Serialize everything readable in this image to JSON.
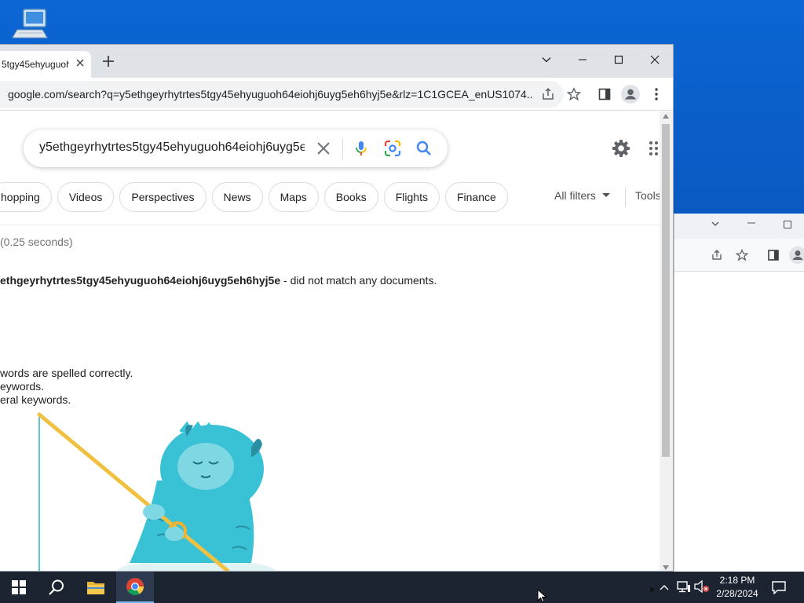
{
  "browser": {
    "tab_title": "5tgy45ehyuguoh",
    "url": "google.com/search?q=y5ethgeyrhytrtes5tgy45ehyuguoh64eiohj6uyg5eh6hyj5e&rlz=1C1GCEA_enUS1074..."
  },
  "search": {
    "query": "y5ethgeyrhytrtes5tgy45ehyuguoh64eiohj6uyg5e"
  },
  "chips": [
    {
      "label": "hopping"
    },
    {
      "label": "Videos"
    },
    {
      "label": "Perspectives"
    },
    {
      "label": "News"
    },
    {
      "label": "Maps"
    },
    {
      "label": "Books"
    },
    {
      "label": "Flights"
    },
    {
      "label": "Finance"
    }
  ],
  "filters": {
    "all_filters": "All filters",
    "tools": "Tools"
  },
  "results": {
    "stats": "0.25 seconds)",
    "no_match_query": "ethgeyrhytrtes5tgy45ehyuguoh64eiohj6uyg5eh6hyj5e",
    "no_match_suffix": " - did not match any documents.",
    "suggestions": [
      "words are spelled correctly.",
      "eywords.",
      "eral keywords."
    ]
  },
  "taskbar": {
    "time": "2:18 PM",
    "date": "2/28/2024"
  },
  "icons": {
    "start": "windows-logo-icon",
    "search": "search-icon",
    "explorer": "folder-icon",
    "chrome": "chrome-icon"
  },
  "colors": {
    "desktop": "#0a5bc4",
    "taskbar": "#1c2432",
    "google_blue": "#4285f4"
  }
}
